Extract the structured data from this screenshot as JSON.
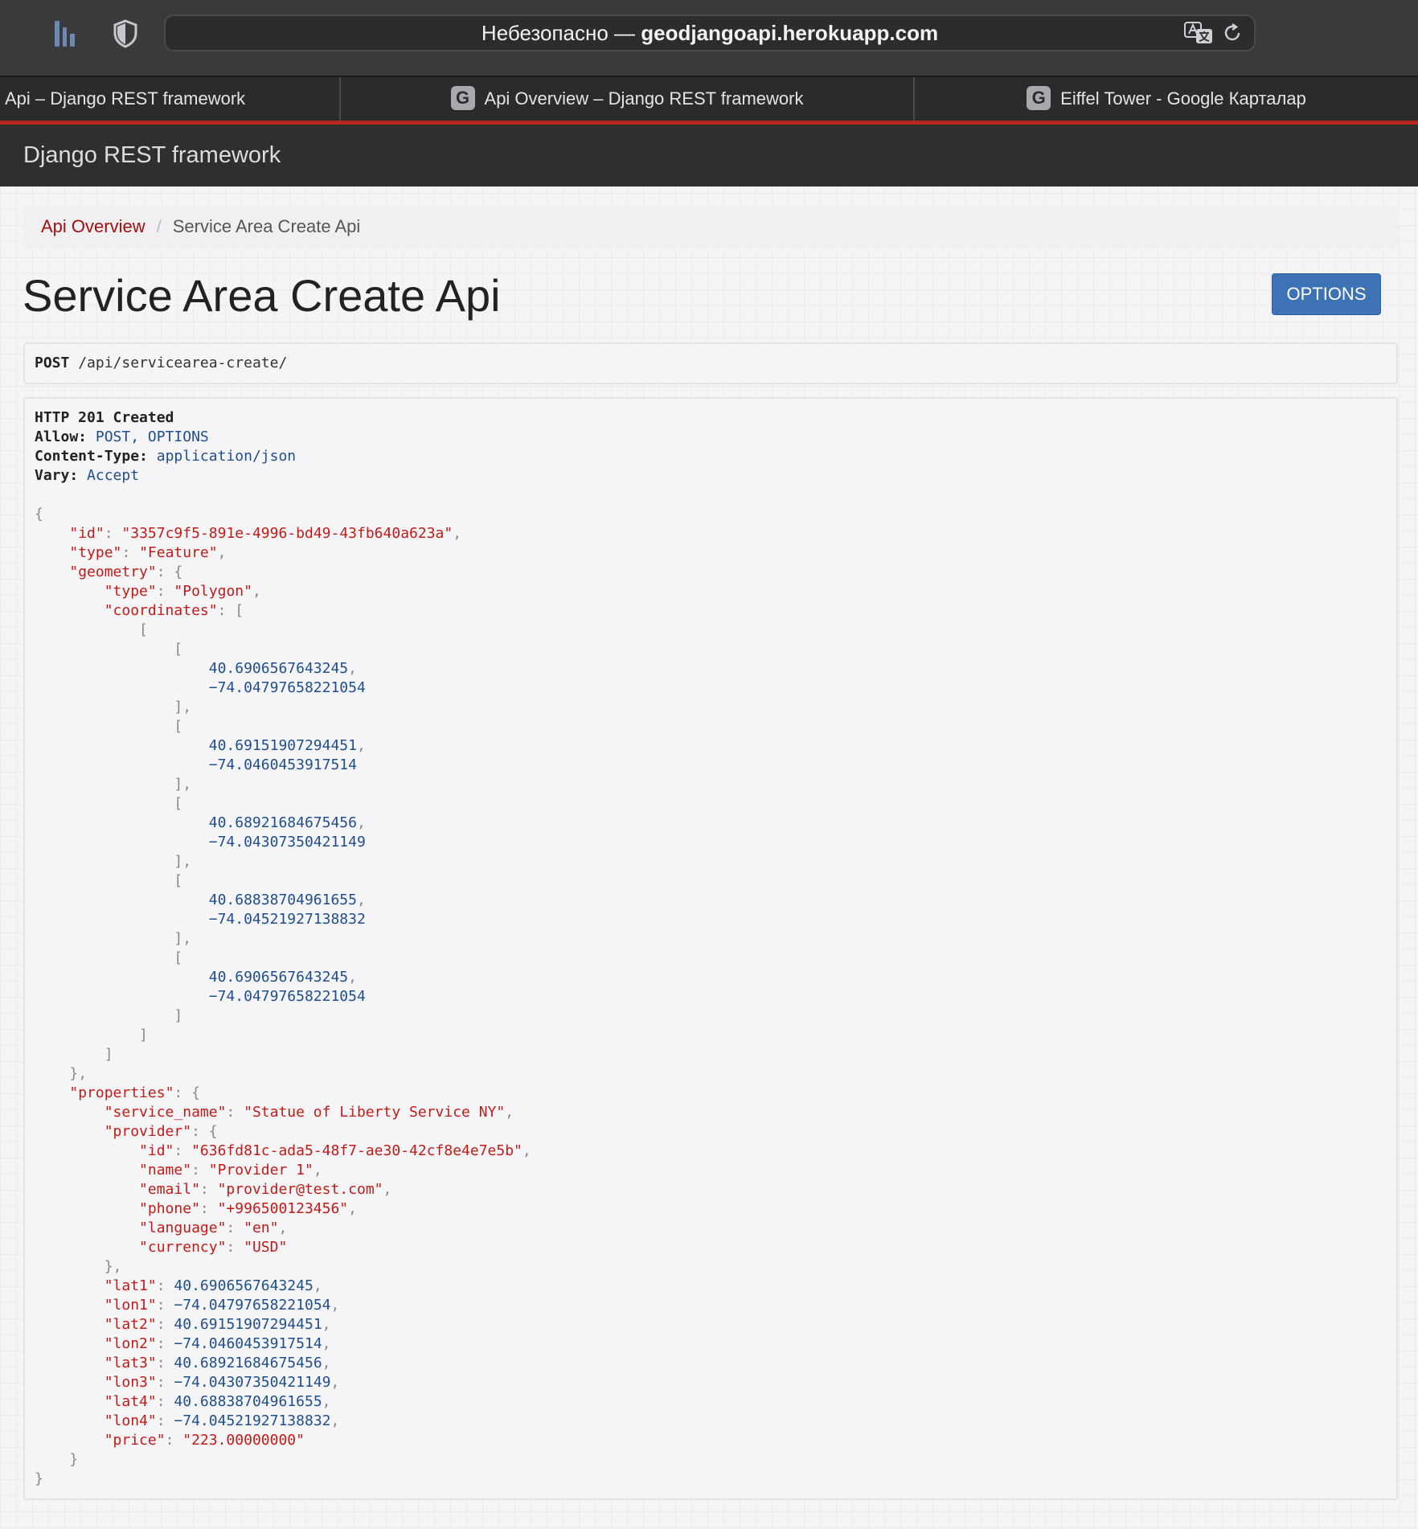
{
  "browser": {
    "address_prefix": "Небезопасно — ",
    "address_host": "geodjangoapi.herokuapp.com",
    "tabs": [
      {
        "label": "Api – Django REST framework",
        "favicon": ""
      },
      {
        "label": "Api Overview – Django REST framework",
        "favicon": "G"
      },
      {
        "label": "Eiffel Tower - Google Карталар",
        "favicon": "G"
      }
    ]
  },
  "navbar": {
    "brand": "Django REST framework"
  },
  "breadcrumb": {
    "link": "Api Overview",
    "divider": "/",
    "current": "Service Area Create Api"
  },
  "page": {
    "title": "Service Area Create Api",
    "options_label": "OPTIONS"
  },
  "request": {
    "method": "POST",
    "path": "/api/servicearea-create/"
  },
  "response": {
    "status": "HTTP 201 Created",
    "headers": [
      {
        "key": "Allow:",
        "value": "POST, OPTIONS"
      },
      {
        "key": "Content-Type:",
        "value": "application/json"
      },
      {
        "key": "Vary:",
        "value": "Accept"
      }
    ],
    "body": {
      "id": "3357c9f5-891e-4996-bd49-43fb640a623a",
      "type": "Feature",
      "geometry": {
        "type": "Polygon",
        "coordinates": [
          [
            [
              40.6906567643245,
              -74.04797658221054
            ],
            [
              40.69151907294451,
              -74.0460453917514
            ],
            [
              40.68921684675456,
              -74.04307350421149
            ],
            [
              40.68838704961655,
              -74.04521927138832
            ],
            [
              40.6906567643245,
              -74.04797658221054
            ]
          ]
        ]
      },
      "properties": {
        "service_name": "Statue of Liberty Service NY",
        "provider": {
          "id": "636fd81c-ada5-48f7-ae30-42cf8e4e7e5b",
          "name": "Provider 1",
          "email": "provider@test.com",
          "phone": "+996500123456",
          "language": "en",
          "currency": "USD"
        },
        "lat1": 40.6906567643245,
        "lon1": -74.04797658221054,
        "lat2": 40.69151907294451,
        "lon2": -74.0460453917514,
        "lat3": 40.68921684675456,
        "lon3": -74.04307350421149,
        "lat4": 40.68838704961655,
        "lon4": -74.04521927138832,
        "price": "223.00000000"
      }
    }
  },
  "colors": {
    "accent": "#b9241f",
    "link": "#a30f0f",
    "button": "#3d72b4",
    "json_string": "#c41a16",
    "json_number": "#1f4e8a"
  },
  "icons": [
    "sidebar-icon",
    "shield-icon",
    "translate-icon",
    "reload-icon",
    "favicon-g-icon"
  ]
}
